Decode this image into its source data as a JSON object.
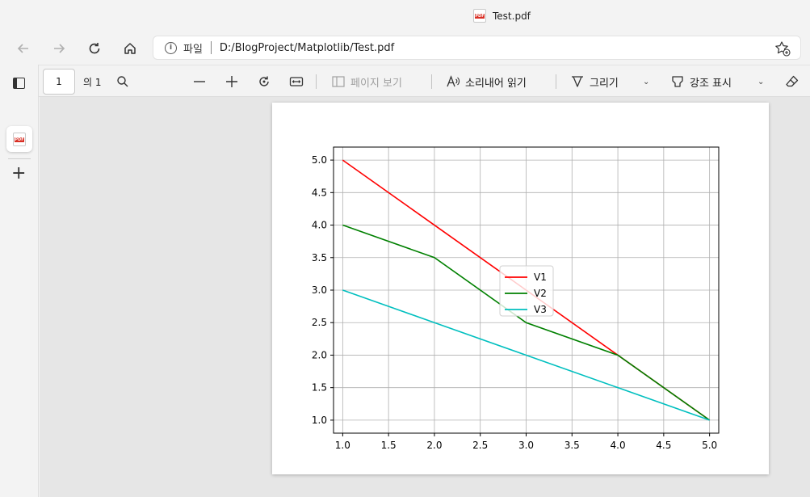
{
  "window": {
    "tab_title": "Test.pdf",
    "pdf_badge": "PDF"
  },
  "navigation": {
    "address_scheme": "파일",
    "address_url": "D:/BlogProject/Matplotlib/Test.pdf",
    "info_glyph": "i"
  },
  "pdf_toolbar": {
    "page_number": "1",
    "page_count": "의 1",
    "page_view_label": "페이지 보기",
    "read_aloud_label": "소리내어 읽기",
    "draw_label": "그리기",
    "highlight_label": "강조 표시"
  },
  "colors": {
    "v1": "#ff0000",
    "v2": "#008000",
    "v3": "#00bfbf",
    "grid": "#b0b0b0"
  },
  "chart_data": {
    "type": "line",
    "title": "",
    "xlabel": "",
    "ylabel": "",
    "xlim": [
      0.9,
      5.1
    ],
    "ylim": [
      0.8,
      5.2
    ],
    "xticks": [
      "1.0",
      "1.5",
      "2.0",
      "2.5",
      "3.0",
      "3.5",
      "4.0",
      "4.5",
      "5.0"
    ],
    "yticks": [
      "1.0",
      "1.5",
      "2.0",
      "2.5",
      "3.0",
      "3.5",
      "4.0",
      "4.5",
      "5.0"
    ],
    "grid": true,
    "legend_position": "center",
    "x": [
      1,
      2,
      3,
      4,
      5
    ],
    "series": [
      {
        "name": "V1",
        "values": [
          5,
          4,
          3,
          2,
          1
        ],
        "color": "#ff0000"
      },
      {
        "name": "V2",
        "values": [
          4,
          3.5,
          2.5,
          2,
          1
        ],
        "color": "#008000"
      },
      {
        "name": "V3",
        "values": [
          3,
          2.5,
          2,
          1.5,
          1
        ],
        "color": "#00bfbf"
      }
    ]
  }
}
